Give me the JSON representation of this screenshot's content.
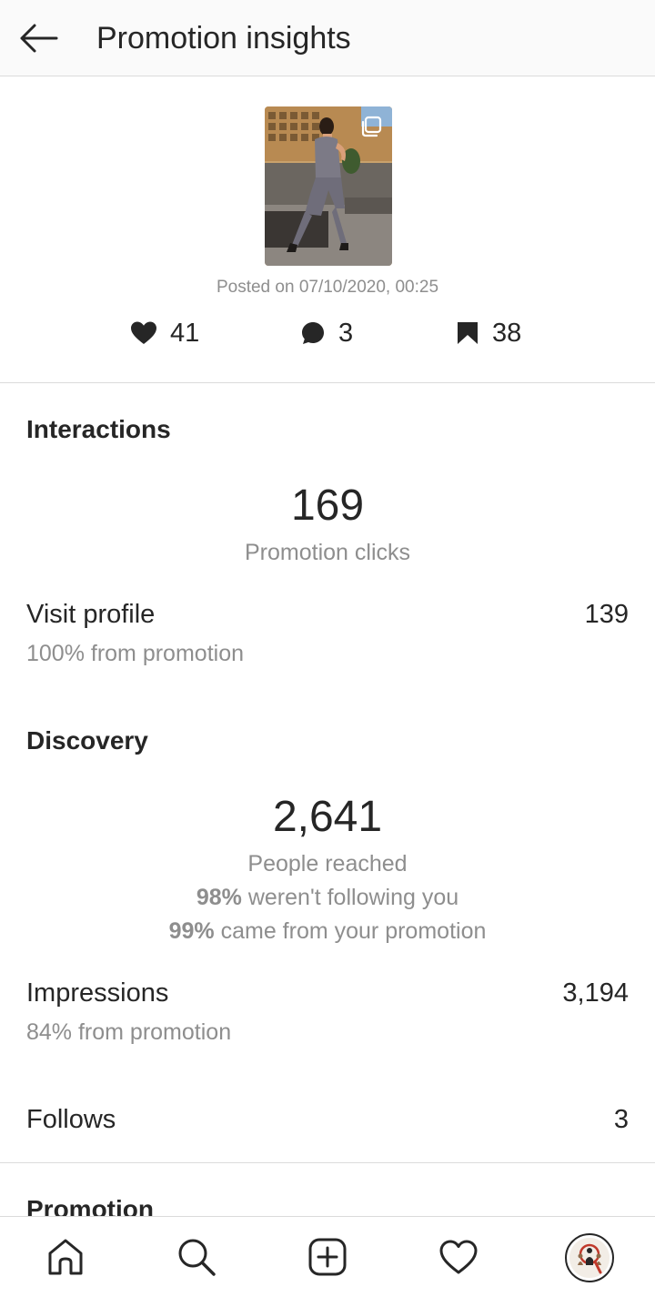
{
  "header": {
    "title": "Promotion insights"
  },
  "post": {
    "posted_on": "Posted on 07/10/2020, 00:25",
    "likes": "41",
    "comments": "3",
    "saves": "38"
  },
  "interactions": {
    "title": "Interactions",
    "total": "169",
    "total_label": "Promotion clicks",
    "visit_profile_label": "Visit profile",
    "visit_profile_value": "139",
    "visit_profile_sub": "100% from promotion"
  },
  "discovery": {
    "title": "Discovery",
    "reached": "2,641",
    "reached_label": "People reached",
    "not_following_pct": "98%",
    "not_following_text": " weren't following you",
    "from_promo_pct": "99%",
    "from_promo_text": " came from your promotion",
    "impressions_label": "Impressions",
    "impressions_value": "3,194",
    "impressions_sub": "84% from promotion",
    "follows_label": "Follows",
    "follows_value": "3"
  },
  "promotion": {
    "title": "Promotion"
  },
  "icons": {
    "back": "arrow-left-icon",
    "likes": "heart-icon",
    "comments": "comment-bubble-icon",
    "saves": "bookmark-icon",
    "multi": "carousel-icon",
    "tabs": [
      "home-icon",
      "search-icon",
      "new-post-icon",
      "activity-heart-icon",
      "profile-avatar"
    ]
  },
  "colors": {
    "text": "#262626",
    "secondary": "#8e8e8e",
    "divider": "#dbdbdb",
    "header_bg": "#fafafa"
  }
}
